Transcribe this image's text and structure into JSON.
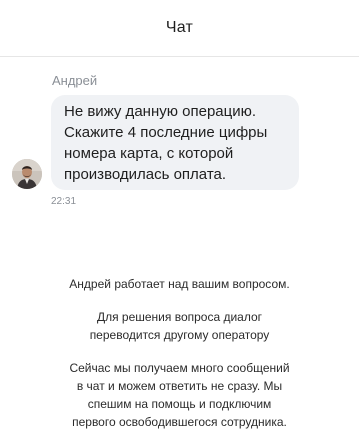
{
  "header": {
    "title": "Чат"
  },
  "message": {
    "sender": "Андрей",
    "lines": [
      "Не вижу данную операцию.",
      "Скажите 4 последние цифры",
      "номера карта, с которой",
      "производилась оплата."
    ],
    "time": "22:31",
    "avatar_icon": "user-photo-avatar"
  },
  "status": {
    "working": "Андрей работает над вашим вопросом.",
    "transfer_lines": [
      "Для решения вопроса диалог",
      "переводится другому оператору"
    ],
    "busy_lines": [
      "Сейчас мы получаем много сообщений",
      "в чат и можем ответить не сразу. Мы",
      "спешим на помощь и подключим",
      "первого освободившегося сотрудника."
    ]
  },
  "colors": {
    "bubble_bg": "#f0f2f5",
    "meta_text": "#8a8f96",
    "divider": "#e6e6e6"
  }
}
